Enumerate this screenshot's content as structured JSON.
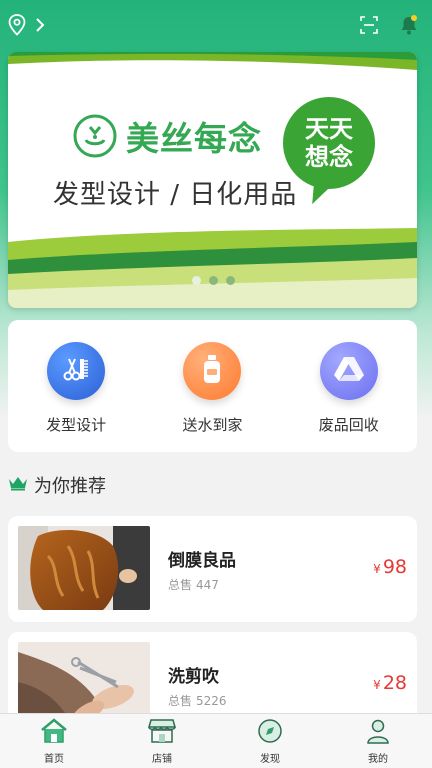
{
  "header": {
    "location_icon": "location-pin-icon",
    "chevron_icon": "chevron-right-icon",
    "scan_icon": "scan-icon",
    "bell_icon": "bell-icon"
  },
  "banner": {
    "brand_name": "美丝每念",
    "slogan": "发型设计 / 日化用品",
    "bubble_line1": "天天",
    "bubble_line2": "想念",
    "slide_count": 3,
    "active_slide": 1
  },
  "services": [
    {
      "label": "发型设计",
      "icon": "scissors-comb-icon",
      "color": "#3b6fe0"
    },
    {
      "label": "送水到家",
      "icon": "water-bottle-icon",
      "color": "#ff8a3d"
    },
    {
      "label": "废品回收",
      "icon": "recycle-triangle-icon",
      "color": "#7b7ff0"
    }
  ],
  "recommend": {
    "title": "为你推荐",
    "icon": "crown-icon"
  },
  "products": [
    {
      "name": "倒膜良品",
      "sold_label": "总售",
      "sold": "447",
      "currency": "¥",
      "price": "98"
    },
    {
      "name": "洗剪吹",
      "sold_label": "总售",
      "sold": "5226",
      "currency": "¥",
      "price": "28"
    }
  ],
  "tabbar": [
    {
      "label": "首页",
      "icon": "home-icon"
    },
    {
      "label": "店铺",
      "icon": "shop-icon"
    },
    {
      "label": "发现",
      "icon": "compass-icon"
    },
    {
      "label": "我的",
      "icon": "user-icon"
    }
  ],
  "colors": {
    "brand_green": "#23b37a",
    "price_red": "#e53935"
  }
}
